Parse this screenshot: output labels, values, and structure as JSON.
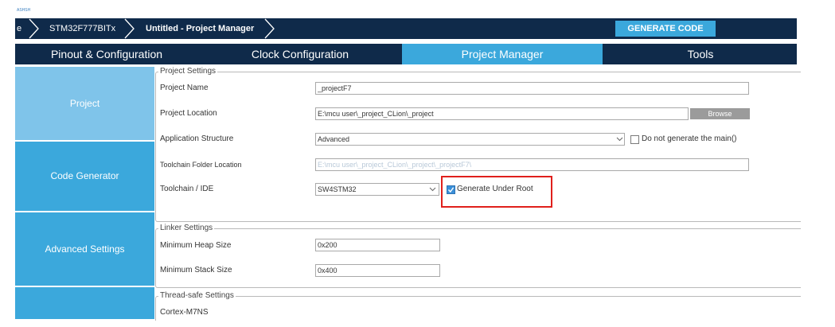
{
  "header": {
    "tiny_text": "ASHSH",
    "breadcrumb": [
      "e",
      "STM32F777BITx",
      "Untitled - Project Manager"
    ],
    "generate_button": "GENERATE CODE"
  },
  "tabs": [
    {
      "label": "Pinout & Configuration",
      "active": false
    },
    {
      "label": "Clock Configuration",
      "active": false
    },
    {
      "label": "Project Manager",
      "active": true
    },
    {
      "label": "Tools",
      "active": false
    }
  ],
  "sidebar": {
    "items": [
      {
        "label": "Project",
        "active": true
      },
      {
        "label": "Code Generator",
        "active": false
      },
      {
        "label": "Advanced Settings",
        "active": false
      }
    ]
  },
  "project_settings": {
    "title": "Project Settings",
    "project_name_label": "Project Name",
    "project_name_value": "_projectF7",
    "project_location_label": "Project Location",
    "project_location_value": "E:\\mcu user\\_project_CLion\\_project",
    "browse_label": "Browse",
    "app_structure_label": "Application Structure",
    "app_structure_value": "Advanced",
    "no_main_label": "Do not generate the main()",
    "no_main_checked": false,
    "toolchain_folder_label": "Toolchain Folder Location",
    "toolchain_folder_value": "E:\\mcu user\\_project_CLion\\_project\\_projectF7\\",
    "toolchain_label": "Toolchain / IDE",
    "toolchain_value": "SW4STM32",
    "gen_root_label": "Generate Under Root",
    "gen_root_checked": true
  },
  "linker_settings": {
    "title": "Linker Settings",
    "heap_label": "Minimum Heap Size",
    "heap_value": "0x200",
    "stack_label": "Minimum Stack Size",
    "stack_value": "0x400"
  },
  "thread_settings": {
    "title": "Thread-safe Settings",
    "core_label": "Cortex-M7NS"
  },
  "colors": {
    "navy": "#0f2a4a",
    "accent": "#3ba8dc",
    "sidebar_active": "#7fc4ea",
    "highlight": "#e0201c"
  }
}
